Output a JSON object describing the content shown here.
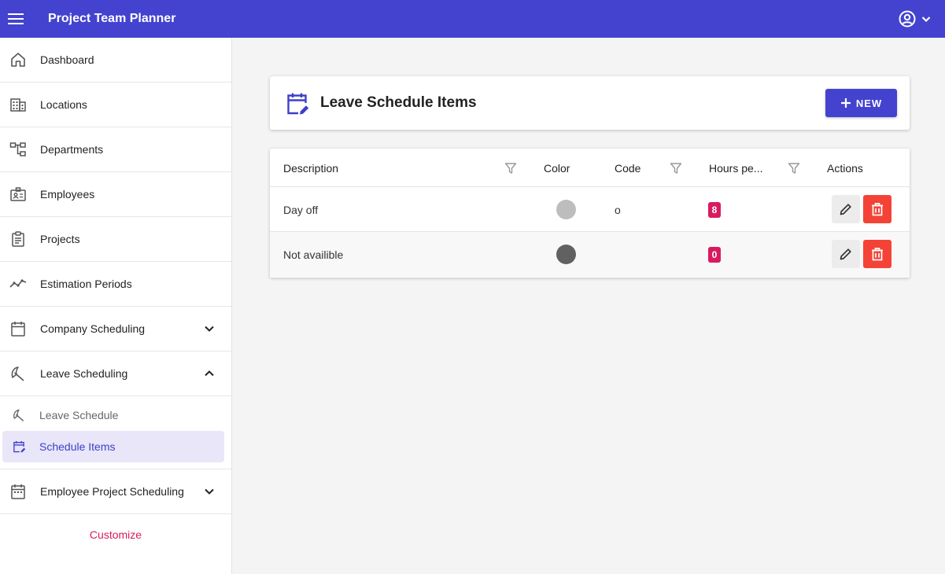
{
  "app": {
    "title": "Project Team Planner"
  },
  "sidebar": {
    "items": [
      {
        "label": "Dashboard"
      },
      {
        "label": "Locations"
      },
      {
        "label": "Departments"
      },
      {
        "label": "Employees"
      },
      {
        "label": "Projects"
      },
      {
        "label": "Estimation Periods"
      },
      {
        "label": "Company Scheduling"
      },
      {
        "label": "Leave Scheduling"
      },
      {
        "label": "Employee Project Scheduling"
      }
    ],
    "leave_sub": [
      {
        "label": "Leave Schedule"
      },
      {
        "label": "Schedule Items"
      }
    ],
    "customize_label": "Customize"
  },
  "page": {
    "title": "Leave Schedule Items",
    "new_button": "NEW"
  },
  "table": {
    "columns": [
      "Description",
      "Color",
      "Code",
      "Hours pe...",
      "Actions"
    ],
    "rows": [
      {
        "description": "Day off",
        "color": "#bdbdbd",
        "code": "o",
        "hours": "8"
      },
      {
        "description": "Not availible",
        "color": "#616161",
        "code": "",
        "hours": "0"
      }
    ]
  },
  "colors": {
    "primary": "#4343d0",
    "accent": "#d81b60",
    "danger": "#f44336"
  }
}
